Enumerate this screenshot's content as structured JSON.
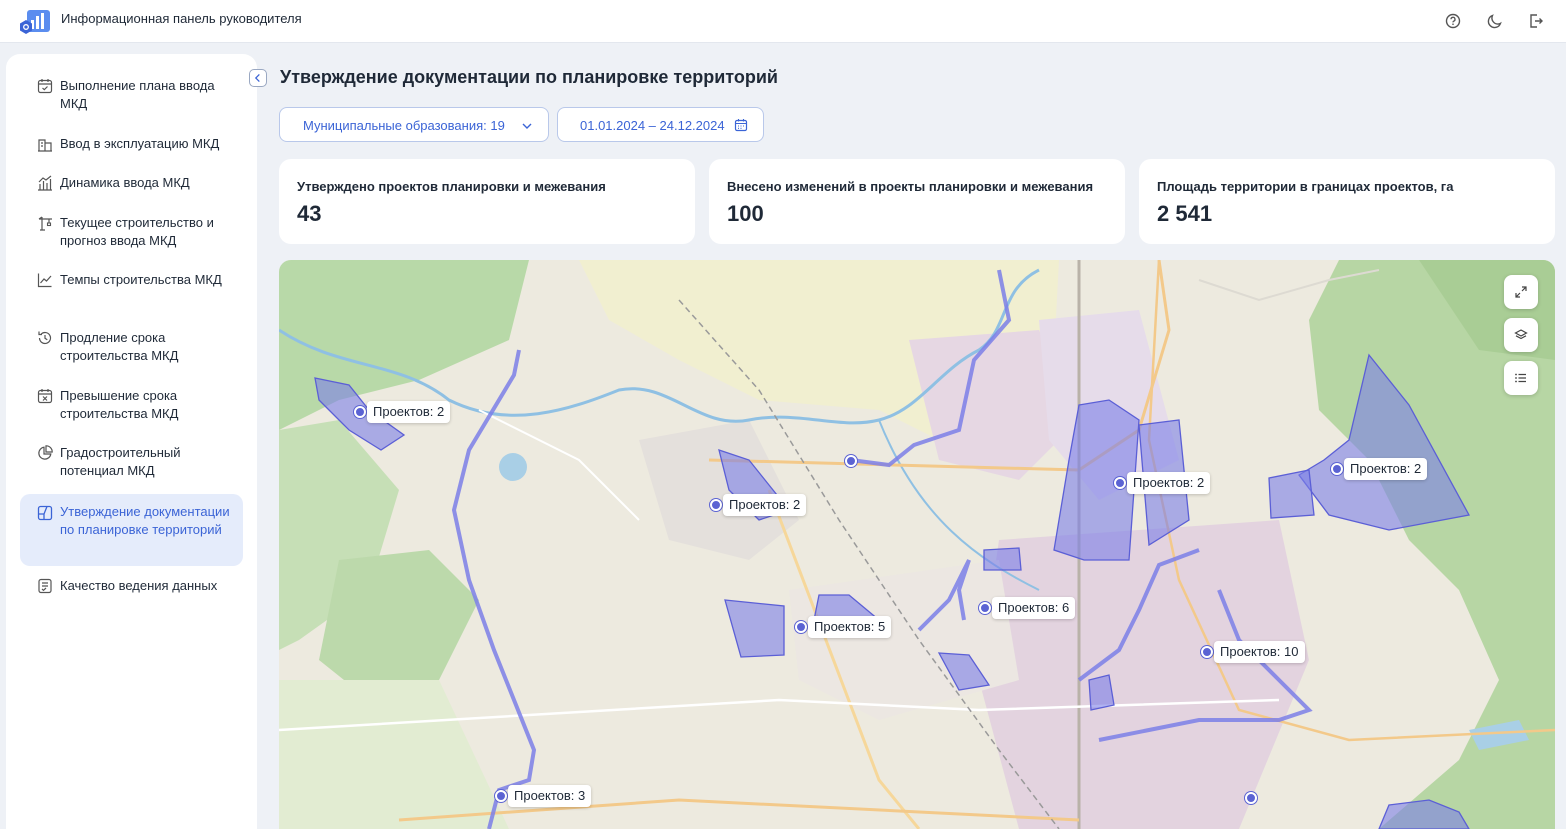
{
  "app": {
    "title": "Информационная панель руководителя",
    "accent_color": "#3b64d6"
  },
  "header_icons": [
    "help-icon",
    "moon-icon",
    "logout-icon"
  ],
  "sidebar": {
    "items": [
      {
        "label": "Выполнение плана ввода МКД",
        "icon": "calendar-check-icon"
      },
      {
        "label": "Ввод в эксплуатацию МКД",
        "icon": "building-icon"
      },
      {
        "label": "Динамика ввода МКД",
        "icon": "building-chart-icon"
      },
      {
        "label": "Текущее строительство и прогноз ввода МКД",
        "icon": "crane-icon"
      },
      {
        "label": "Темпы строительства МКД",
        "icon": "trend-chart-icon"
      },
      {
        "label": "Продление срока строительства МКД",
        "icon": "history-icon"
      },
      {
        "label": "Превышение срока строительства МКД",
        "icon": "calendar-x-icon"
      },
      {
        "label": "Градостроительный потенциал МКД",
        "icon": "pie-chart-icon"
      },
      {
        "label": "Утверждение документации по планировке территорий",
        "icon": "map-layout-icon",
        "active": true
      },
      {
        "label": "Качество ведения данных",
        "icon": "checklist-icon"
      }
    ]
  },
  "page": {
    "title": "Утверждение документации по планировке территорий"
  },
  "filters": {
    "municipal": "Муниципальные образования: 19",
    "date_range": "01.01.2024 – 24.12.2024"
  },
  "kpis": [
    {
      "label": "Утверждено проектов планировки и межевания",
      "value": "43"
    },
    {
      "label": "Внесено изменений в проекты планировки и межевания",
      "value": "100"
    },
    {
      "label": "Площадь территории в границах проектов, га",
      "value": "2 541"
    }
  ],
  "map": {
    "controls": [
      "fullscreen-icon",
      "layers-icon",
      "list-icon"
    ],
    "markers": [
      {
        "label": "Проектов: 2"
      },
      {
        "label": "Проектов: 2"
      },
      {
        "label": "Проектов: 2"
      },
      {
        "label": "Проектов: 2"
      },
      {
        "label": "Проектов: 5"
      },
      {
        "label": "Проектов: 6"
      },
      {
        "label": "Проектов: 10"
      },
      {
        "label": "Проектов: 3"
      }
    ],
    "polygon_color": "#7b7fe8"
  }
}
